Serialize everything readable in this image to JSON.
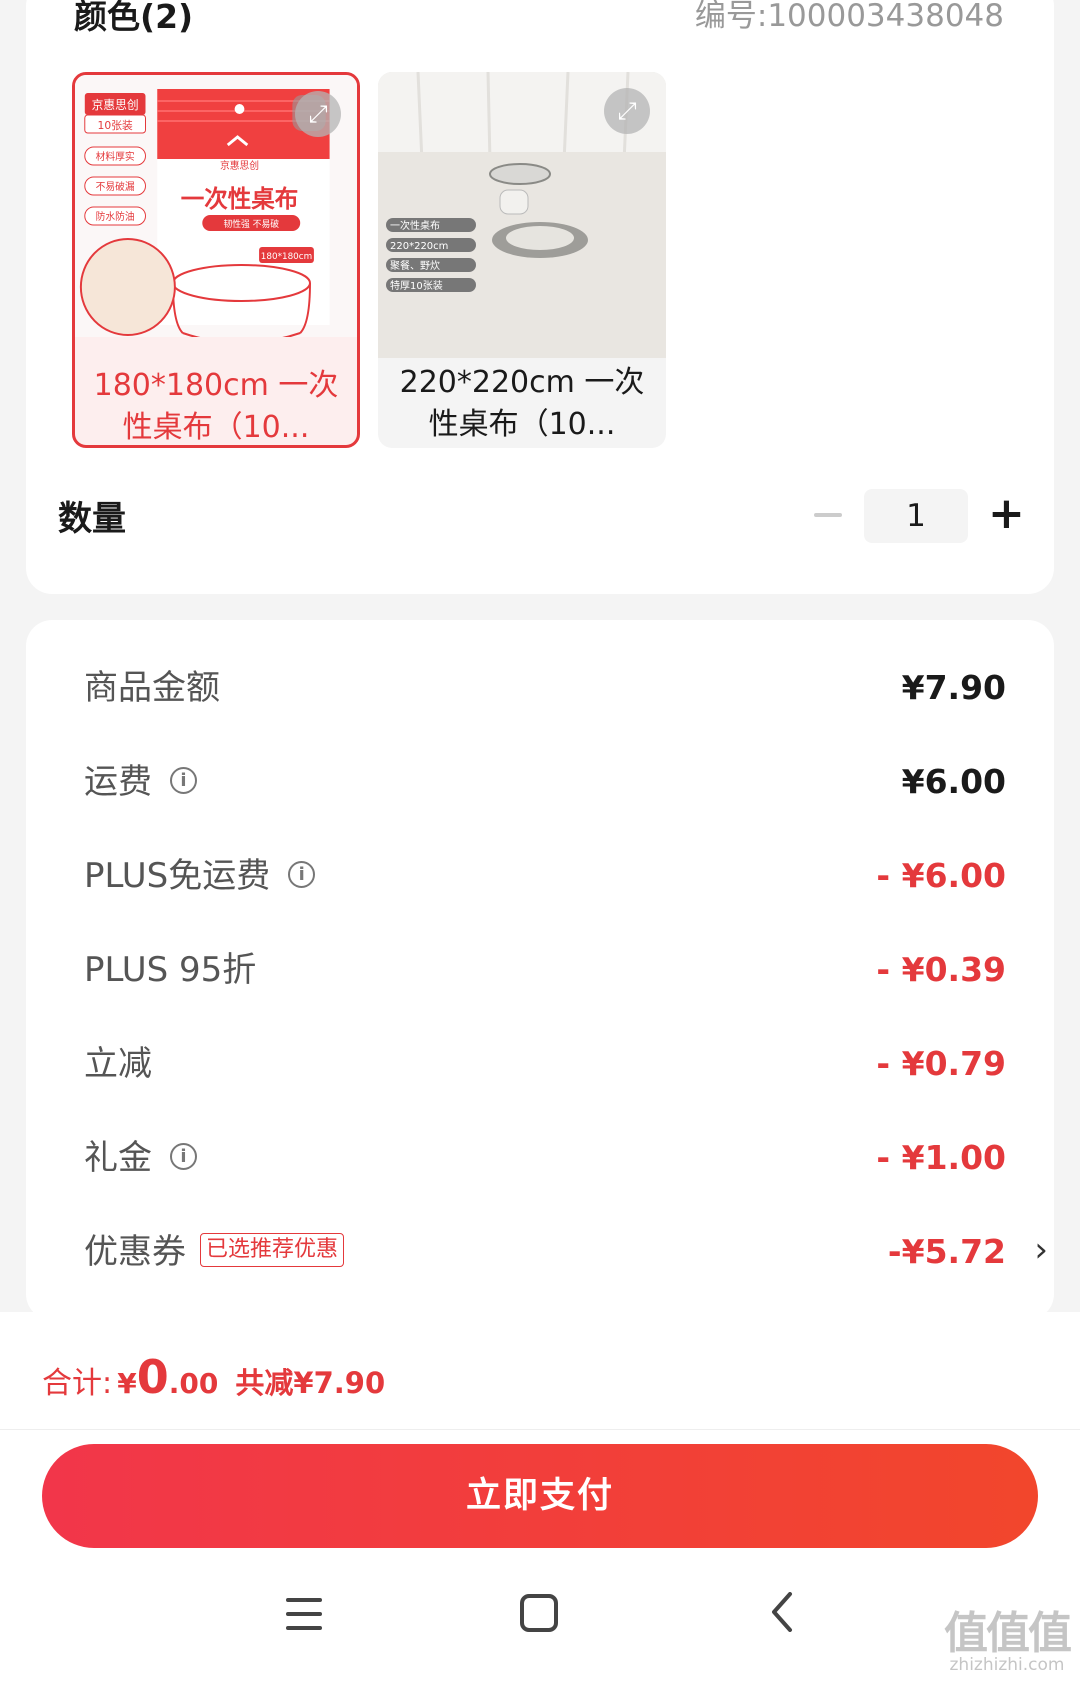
{
  "header": {
    "color_title": "颜色(2)",
    "sku_code": "编号:100003438048"
  },
  "options": [
    {
      "label": "180*180cm 一次性桌布（10...",
      "selected": true,
      "image": {
        "brand": "京惠思创",
        "count": "10张装",
        "features": [
          "材料厚实",
          "不易破漏",
          "防水防油"
        ],
        "title": "一次性桌布",
        "subtitle": "韧性强 不易破",
        "size": "180*180cm"
      }
    },
    {
      "label": "220*220cm 一次性桌布（10...",
      "selected": false,
      "image": {
        "tags": [
          "一次性桌布",
          "220*220cm",
          "聚餐、野炊",
          "特厚10张装"
        ]
      }
    }
  ],
  "quantity": {
    "label": "数量",
    "value": "1"
  },
  "summary": [
    {
      "name": "商品金额",
      "amount": "¥7.90",
      "info": false,
      "red": false
    },
    {
      "name": "运费",
      "amount": "¥6.00",
      "info": true,
      "red": false
    },
    {
      "name": "PLUS免运费",
      "amount": "- ¥6.00",
      "info": true,
      "red": true
    },
    {
      "name": "PLUS 95折",
      "amount": "- ¥0.39",
      "info": false,
      "red": true
    },
    {
      "name": "立减",
      "amount": "- ¥0.79",
      "info": false,
      "red": true
    },
    {
      "name": "礼金",
      "amount": "- ¥1.00",
      "info": true,
      "red": true
    }
  ],
  "coupon": {
    "name": "优惠券",
    "tag": "已选推荐优惠",
    "amount": "-¥5.72",
    "chevron": "›"
  },
  "total": {
    "label": "合计:",
    "currency": "¥",
    "integer": "0",
    "decimal": ".00",
    "saved": "共减¥7.90"
  },
  "pay_button": "立即支付",
  "nav": [
    "menu-icon",
    "home-icon",
    "back-icon"
  ],
  "watermark": {
    "big": "值值值",
    "small": "zhizhizhi.com"
  },
  "colors": {
    "accent": "#e4393c",
    "button": "#f2364a"
  }
}
